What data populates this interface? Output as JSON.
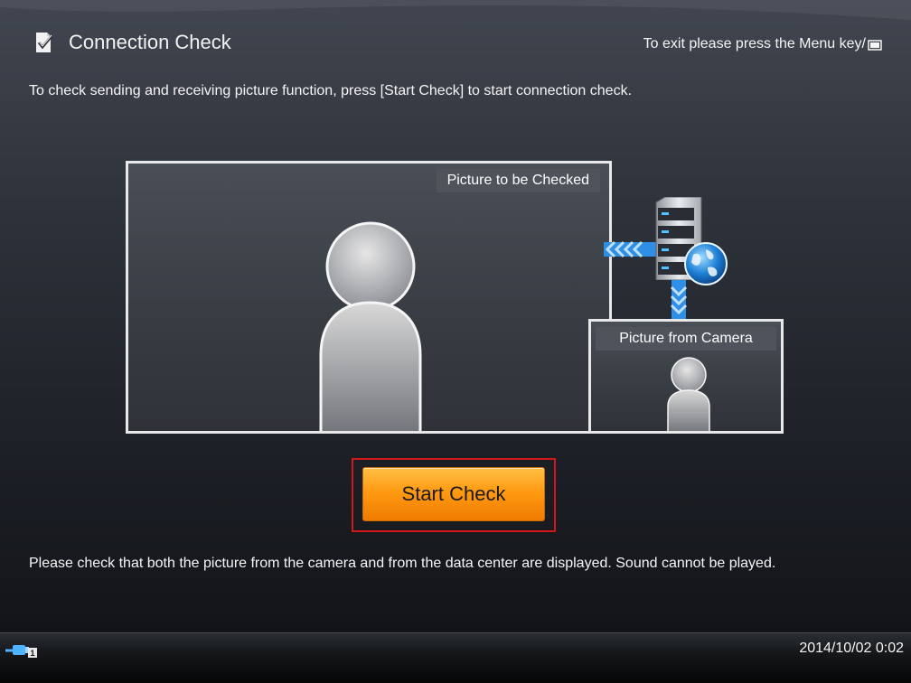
{
  "header": {
    "title": "Connection Check",
    "title_icon": "checklist-icon",
    "exit_hint": "To exit please press the Menu key/",
    "menu_key_icon": "menu-key-icon"
  },
  "instruction": "To check sending and receiving picture function, press [Start Check] to start connection check.",
  "preview": {
    "main_label": "Picture to be Checked",
    "camera_label": "Picture from Camera",
    "server_icon": "server-icon",
    "globe_icon": "globe-icon"
  },
  "start_button": {
    "label": "Start Check"
  },
  "note": "Please check that both the picture from the camera and from the data center are displayed. Sound cannot be played.",
  "footer": {
    "usb_icon": "usb-icon",
    "usb_badge": "1",
    "datetime": "2014/10/02 0:02"
  },
  "colors": {
    "accent_button": "#ff9a12",
    "selection_border": "#d01818",
    "arrow_blue": "#2f8fe6"
  }
}
